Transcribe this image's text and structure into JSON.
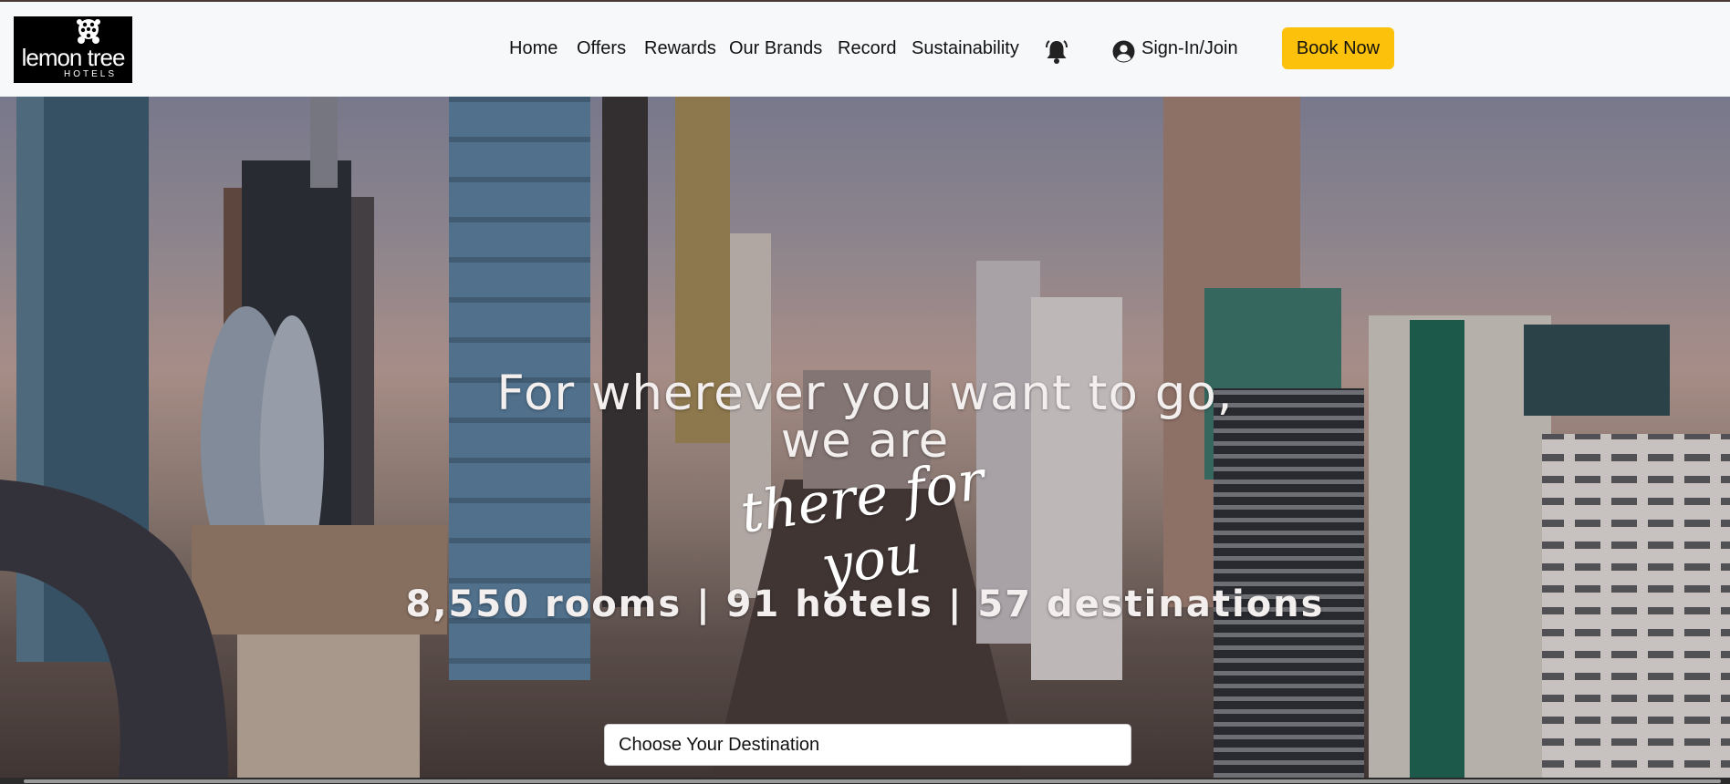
{
  "brand": {
    "logo_main": "lemon tree",
    "logo_sub": "HOTELS"
  },
  "nav": {
    "items": [
      {
        "label": "Home"
      },
      {
        "label": "Offers"
      },
      {
        "label": "Rewards"
      },
      {
        "label": "Our Brands"
      },
      {
        "label": "Record"
      },
      {
        "label": "Sustainability"
      }
    ],
    "notification_icon": "bell-icon",
    "signin_icon": "user-circle-icon",
    "signin_label": "Sign-In/Join",
    "book_label": "Book Now"
  },
  "hero": {
    "headline_line1": "For wherever you want to go,",
    "headline_line2": "we are",
    "script_text": "there for you",
    "stats": "8,550 rooms | 91 hotels | 57 destinations"
  },
  "search": {
    "placeholder": "Choose Your Destination"
  },
  "colors": {
    "book_button": "#fcc10a",
    "navbar_bg": "#f7f8fa",
    "logo_bg": "#000000"
  }
}
